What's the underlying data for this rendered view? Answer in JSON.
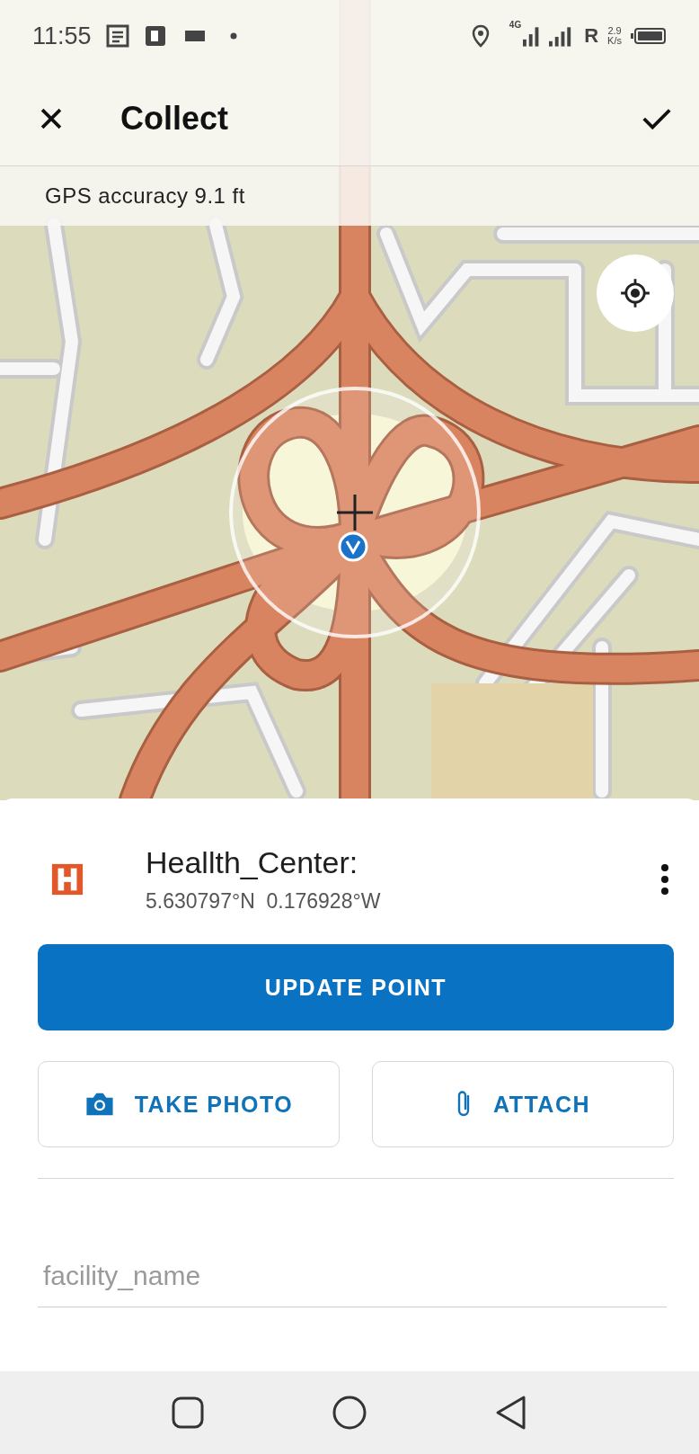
{
  "status_bar": {
    "time": "11:55",
    "network_type": "4G",
    "roaming": "R",
    "speed": "2.9",
    "speed_unit": "K/s"
  },
  "toolbar": {
    "title": "Collect"
  },
  "gps_accuracy": "GPS accuracy 9.1 ft",
  "feature": {
    "title": "Heallth_Center:",
    "coordinates": "5.630797°N  0.176928°W"
  },
  "primary_button": "UPDATE POINT",
  "secondary_buttons": [
    {
      "kind": "camera",
      "label": "TAKE PHOTO"
    },
    {
      "kind": "attachment",
      "label": "ATTACH"
    }
  ],
  "fields": [
    {
      "placeholder": "facility_name"
    }
  ]
}
